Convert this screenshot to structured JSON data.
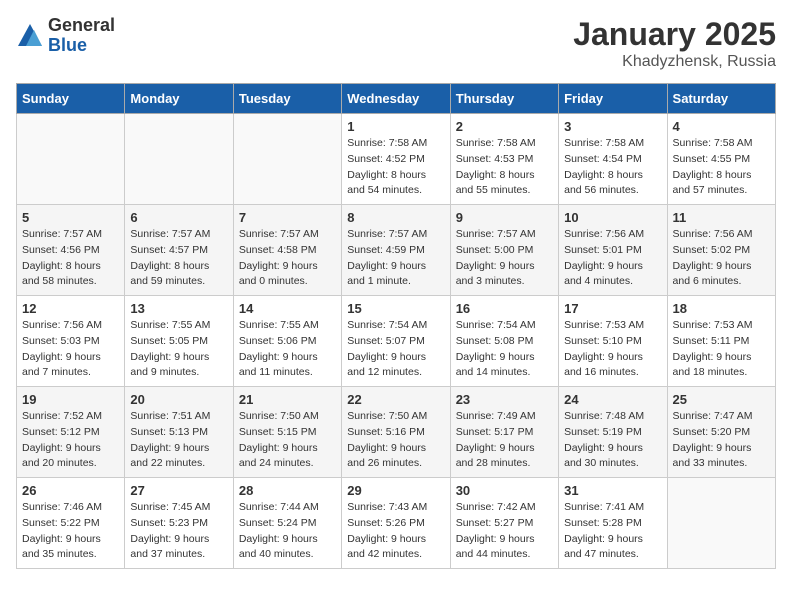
{
  "logo": {
    "general": "General",
    "blue": "Blue"
  },
  "title": "January 2025",
  "location": "Khadyzhensk, Russia",
  "weekdays": [
    "Sunday",
    "Monday",
    "Tuesday",
    "Wednesday",
    "Thursday",
    "Friday",
    "Saturday"
  ],
  "weeks": [
    [
      {
        "day": "",
        "sunrise": "",
        "sunset": "",
        "daylight": ""
      },
      {
        "day": "",
        "sunrise": "",
        "sunset": "",
        "daylight": ""
      },
      {
        "day": "",
        "sunrise": "",
        "sunset": "",
        "daylight": ""
      },
      {
        "day": "1",
        "sunrise": "Sunrise: 7:58 AM",
        "sunset": "Sunset: 4:52 PM",
        "daylight": "Daylight: 8 hours and 54 minutes."
      },
      {
        "day": "2",
        "sunrise": "Sunrise: 7:58 AM",
        "sunset": "Sunset: 4:53 PM",
        "daylight": "Daylight: 8 hours and 55 minutes."
      },
      {
        "day": "3",
        "sunrise": "Sunrise: 7:58 AM",
        "sunset": "Sunset: 4:54 PM",
        "daylight": "Daylight: 8 hours and 56 minutes."
      },
      {
        "day": "4",
        "sunrise": "Sunrise: 7:58 AM",
        "sunset": "Sunset: 4:55 PM",
        "daylight": "Daylight: 8 hours and 57 minutes."
      }
    ],
    [
      {
        "day": "5",
        "sunrise": "Sunrise: 7:57 AM",
        "sunset": "Sunset: 4:56 PM",
        "daylight": "Daylight: 8 hours and 58 minutes."
      },
      {
        "day": "6",
        "sunrise": "Sunrise: 7:57 AM",
        "sunset": "Sunset: 4:57 PM",
        "daylight": "Daylight: 8 hours and 59 minutes."
      },
      {
        "day": "7",
        "sunrise": "Sunrise: 7:57 AM",
        "sunset": "Sunset: 4:58 PM",
        "daylight": "Daylight: 9 hours and 0 minutes."
      },
      {
        "day": "8",
        "sunrise": "Sunrise: 7:57 AM",
        "sunset": "Sunset: 4:59 PM",
        "daylight": "Daylight: 9 hours and 1 minute."
      },
      {
        "day": "9",
        "sunrise": "Sunrise: 7:57 AM",
        "sunset": "Sunset: 5:00 PM",
        "daylight": "Daylight: 9 hours and 3 minutes."
      },
      {
        "day": "10",
        "sunrise": "Sunrise: 7:56 AM",
        "sunset": "Sunset: 5:01 PM",
        "daylight": "Daylight: 9 hours and 4 minutes."
      },
      {
        "day": "11",
        "sunrise": "Sunrise: 7:56 AM",
        "sunset": "Sunset: 5:02 PM",
        "daylight": "Daylight: 9 hours and 6 minutes."
      }
    ],
    [
      {
        "day": "12",
        "sunrise": "Sunrise: 7:56 AM",
        "sunset": "Sunset: 5:03 PM",
        "daylight": "Daylight: 9 hours and 7 minutes."
      },
      {
        "day": "13",
        "sunrise": "Sunrise: 7:55 AM",
        "sunset": "Sunset: 5:05 PM",
        "daylight": "Daylight: 9 hours and 9 minutes."
      },
      {
        "day": "14",
        "sunrise": "Sunrise: 7:55 AM",
        "sunset": "Sunset: 5:06 PM",
        "daylight": "Daylight: 9 hours and 11 minutes."
      },
      {
        "day": "15",
        "sunrise": "Sunrise: 7:54 AM",
        "sunset": "Sunset: 5:07 PM",
        "daylight": "Daylight: 9 hours and 12 minutes."
      },
      {
        "day": "16",
        "sunrise": "Sunrise: 7:54 AM",
        "sunset": "Sunset: 5:08 PM",
        "daylight": "Daylight: 9 hours and 14 minutes."
      },
      {
        "day": "17",
        "sunrise": "Sunrise: 7:53 AM",
        "sunset": "Sunset: 5:10 PM",
        "daylight": "Daylight: 9 hours and 16 minutes."
      },
      {
        "day": "18",
        "sunrise": "Sunrise: 7:53 AM",
        "sunset": "Sunset: 5:11 PM",
        "daylight": "Daylight: 9 hours and 18 minutes."
      }
    ],
    [
      {
        "day": "19",
        "sunrise": "Sunrise: 7:52 AM",
        "sunset": "Sunset: 5:12 PM",
        "daylight": "Daylight: 9 hours and 20 minutes."
      },
      {
        "day": "20",
        "sunrise": "Sunrise: 7:51 AM",
        "sunset": "Sunset: 5:13 PM",
        "daylight": "Daylight: 9 hours and 22 minutes."
      },
      {
        "day": "21",
        "sunrise": "Sunrise: 7:50 AM",
        "sunset": "Sunset: 5:15 PM",
        "daylight": "Daylight: 9 hours and 24 minutes."
      },
      {
        "day": "22",
        "sunrise": "Sunrise: 7:50 AM",
        "sunset": "Sunset: 5:16 PM",
        "daylight": "Daylight: 9 hours and 26 minutes."
      },
      {
        "day": "23",
        "sunrise": "Sunrise: 7:49 AM",
        "sunset": "Sunset: 5:17 PM",
        "daylight": "Daylight: 9 hours and 28 minutes."
      },
      {
        "day": "24",
        "sunrise": "Sunrise: 7:48 AM",
        "sunset": "Sunset: 5:19 PM",
        "daylight": "Daylight: 9 hours and 30 minutes."
      },
      {
        "day": "25",
        "sunrise": "Sunrise: 7:47 AM",
        "sunset": "Sunset: 5:20 PM",
        "daylight": "Daylight: 9 hours and 33 minutes."
      }
    ],
    [
      {
        "day": "26",
        "sunrise": "Sunrise: 7:46 AM",
        "sunset": "Sunset: 5:22 PM",
        "daylight": "Daylight: 9 hours and 35 minutes."
      },
      {
        "day": "27",
        "sunrise": "Sunrise: 7:45 AM",
        "sunset": "Sunset: 5:23 PM",
        "daylight": "Daylight: 9 hours and 37 minutes."
      },
      {
        "day": "28",
        "sunrise": "Sunrise: 7:44 AM",
        "sunset": "Sunset: 5:24 PM",
        "daylight": "Daylight: 9 hours and 40 minutes."
      },
      {
        "day": "29",
        "sunrise": "Sunrise: 7:43 AM",
        "sunset": "Sunset: 5:26 PM",
        "daylight": "Daylight: 9 hours and 42 minutes."
      },
      {
        "day": "30",
        "sunrise": "Sunrise: 7:42 AM",
        "sunset": "Sunset: 5:27 PM",
        "daylight": "Daylight: 9 hours and 44 minutes."
      },
      {
        "day": "31",
        "sunrise": "Sunrise: 7:41 AM",
        "sunset": "Sunset: 5:28 PM",
        "daylight": "Daylight: 9 hours and 47 minutes."
      },
      {
        "day": "",
        "sunrise": "",
        "sunset": "",
        "daylight": ""
      }
    ]
  ]
}
